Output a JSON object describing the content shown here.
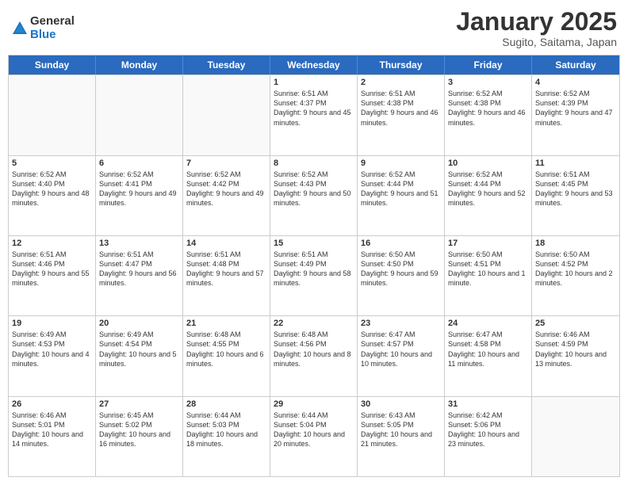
{
  "header": {
    "logo_general": "General",
    "logo_blue": "Blue",
    "month_title": "January 2025",
    "location": "Sugito, Saitama, Japan"
  },
  "days_of_week": [
    "Sunday",
    "Monday",
    "Tuesday",
    "Wednesday",
    "Thursday",
    "Friday",
    "Saturday"
  ],
  "weeks": [
    [
      {
        "day": "",
        "info": "",
        "empty": true
      },
      {
        "day": "",
        "info": "",
        "empty": true
      },
      {
        "day": "",
        "info": "",
        "empty": true
      },
      {
        "day": "1",
        "info": "Sunrise: 6:51 AM\nSunset: 4:37 PM\nDaylight: 9 hours and 45 minutes."
      },
      {
        "day": "2",
        "info": "Sunrise: 6:51 AM\nSunset: 4:38 PM\nDaylight: 9 hours and 46 minutes."
      },
      {
        "day": "3",
        "info": "Sunrise: 6:52 AM\nSunset: 4:38 PM\nDaylight: 9 hours and 46 minutes."
      },
      {
        "day": "4",
        "info": "Sunrise: 6:52 AM\nSunset: 4:39 PM\nDaylight: 9 hours and 47 minutes."
      }
    ],
    [
      {
        "day": "5",
        "info": "Sunrise: 6:52 AM\nSunset: 4:40 PM\nDaylight: 9 hours and 48 minutes."
      },
      {
        "day": "6",
        "info": "Sunrise: 6:52 AM\nSunset: 4:41 PM\nDaylight: 9 hours and 49 minutes."
      },
      {
        "day": "7",
        "info": "Sunrise: 6:52 AM\nSunset: 4:42 PM\nDaylight: 9 hours and 49 minutes."
      },
      {
        "day": "8",
        "info": "Sunrise: 6:52 AM\nSunset: 4:43 PM\nDaylight: 9 hours and 50 minutes."
      },
      {
        "day": "9",
        "info": "Sunrise: 6:52 AM\nSunset: 4:44 PM\nDaylight: 9 hours and 51 minutes."
      },
      {
        "day": "10",
        "info": "Sunrise: 6:52 AM\nSunset: 4:44 PM\nDaylight: 9 hours and 52 minutes."
      },
      {
        "day": "11",
        "info": "Sunrise: 6:51 AM\nSunset: 4:45 PM\nDaylight: 9 hours and 53 minutes."
      }
    ],
    [
      {
        "day": "12",
        "info": "Sunrise: 6:51 AM\nSunset: 4:46 PM\nDaylight: 9 hours and 55 minutes."
      },
      {
        "day": "13",
        "info": "Sunrise: 6:51 AM\nSunset: 4:47 PM\nDaylight: 9 hours and 56 minutes."
      },
      {
        "day": "14",
        "info": "Sunrise: 6:51 AM\nSunset: 4:48 PM\nDaylight: 9 hours and 57 minutes."
      },
      {
        "day": "15",
        "info": "Sunrise: 6:51 AM\nSunset: 4:49 PM\nDaylight: 9 hours and 58 minutes."
      },
      {
        "day": "16",
        "info": "Sunrise: 6:50 AM\nSunset: 4:50 PM\nDaylight: 9 hours and 59 minutes."
      },
      {
        "day": "17",
        "info": "Sunrise: 6:50 AM\nSunset: 4:51 PM\nDaylight: 10 hours and 1 minute."
      },
      {
        "day": "18",
        "info": "Sunrise: 6:50 AM\nSunset: 4:52 PM\nDaylight: 10 hours and 2 minutes."
      }
    ],
    [
      {
        "day": "19",
        "info": "Sunrise: 6:49 AM\nSunset: 4:53 PM\nDaylight: 10 hours and 4 minutes."
      },
      {
        "day": "20",
        "info": "Sunrise: 6:49 AM\nSunset: 4:54 PM\nDaylight: 10 hours and 5 minutes."
      },
      {
        "day": "21",
        "info": "Sunrise: 6:48 AM\nSunset: 4:55 PM\nDaylight: 10 hours and 6 minutes."
      },
      {
        "day": "22",
        "info": "Sunrise: 6:48 AM\nSunset: 4:56 PM\nDaylight: 10 hours and 8 minutes."
      },
      {
        "day": "23",
        "info": "Sunrise: 6:47 AM\nSunset: 4:57 PM\nDaylight: 10 hours and 10 minutes."
      },
      {
        "day": "24",
        "info": "Sunrise: 6:47 AM\nSunset: 4:58 PM\nDaylight: 10 hours and 11 minutes."
      },
      {
        "day": "25",
        "info": "Sunrise: 6:46 AM\nSunset: 4:59 PM\nDaylight: 10 hours and 13 minutes."
      }
    ],
    [
      {
        "day": "26",
        "info": "Sunrise: 6:46 AM\nSunset: 5:01 PM\nDaylight: 10 hours and 14 minutes."
      },
      {
        "day": "27",
        "info": "Sunrise: 6:45 AM\nSunset: 5:02 PM\nDaylight: 10 hours and 16 minutes."
      },
      {
        "day": "28",
        "info": "Sunrise: 6:44 AM\nSunset: 5:03 PM\nDaylight: 10 hours and 18 minutes."
      },
      {
        "day": "29",
        "info": "Sunrise: 6:44 AM\nSunset: 5:04 PM\nDaylight: 10 hours and 20 minutes."
      },
      {
        "day": "30",
        "info": "Sunrise: 6:43 AM\nSunset: 5:05 PM\nDaylight: 10 hours and 21 minutes."
      },
      {
        "day": "31",
        "info": "Sunrise: 6:42 AM\nSunset: 5:06 PM\nDaylight: 10 hours and 23 minutes."
      },
      {
        "day": "",
        "info": "",
        "empty": true
      }
    ]
  ]
}
